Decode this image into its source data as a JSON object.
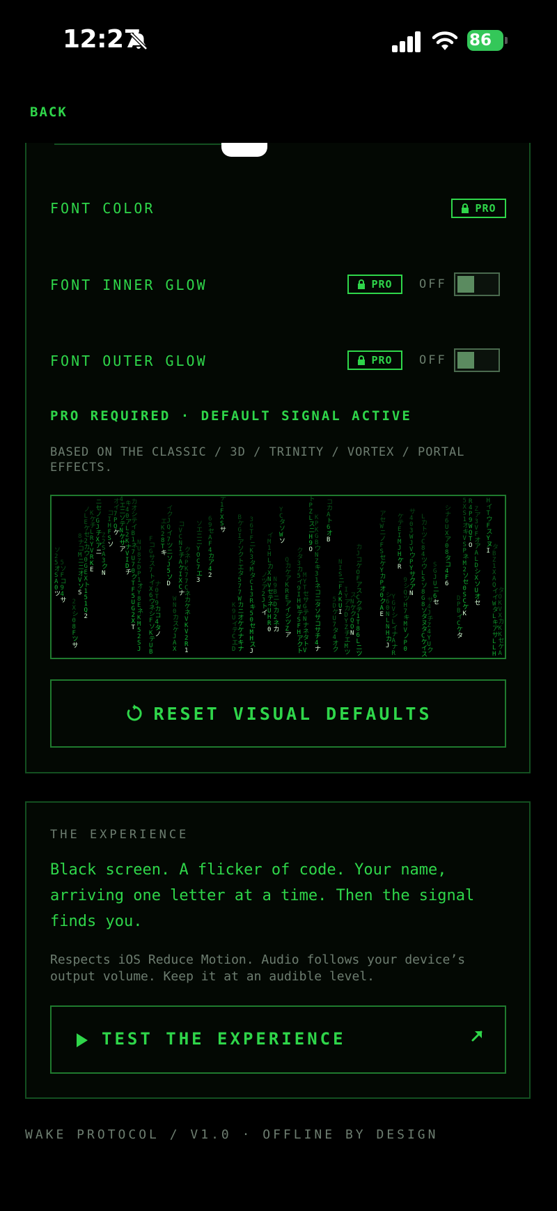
{
  "status_bar": {
    "time": "12:27",
    "battery_percent": "86",
    "icons": [
      "bell-slash-icon",
      "signal-icon",
      "wifi-icon",
      "battery-charging-icon"
    ]
  },
  "nav": {
    "back_label": "BACK"
  },
  "visual": {
    "rows": [
      {
        "label": "FONT COLOR",
        "badge": "PRO"
      },
      {
        "label": "FONT INNER GLOW",
        "badge": "PRO",
        "state": "OFF"
      },
      {
        "label": "FONT OUTER GLOW",
        "badge": "PRO",
        "state": "OFF"
      }
    ],
    "pro_required": "PRO REQUIRED · DEFAULT SIGNAL ACTIVE",
    "based_on": "BASED ON THE CLASSIC / 3D / TRINITY / VORTEX / PORTAL EFFECTS.",
    "reset_label": "RESET VISUAL DEFAULTS"
  },
  "experience": {
    "heading": "THE EXPERIENCE",
    "body": "Black screen. A flicker of code. Your name, arriving one letter at a time. Then the signal finds you.",
    "note": "Respects iOS Reduce Motion. Audio follows your device’s output volume. Keep it at an audible level.",
    "test_label": "TEST THE EXPERIENCE"
  },
  "footer": "WAKE PROTOCOL / V1.0 · OFFLINE BY DESIGN",
  "colors": {
    "accent": "#2fd64a",
    "muted": "#6d7d70",
    "border": "#134f20",
    "background": "#000000"
  }
}
